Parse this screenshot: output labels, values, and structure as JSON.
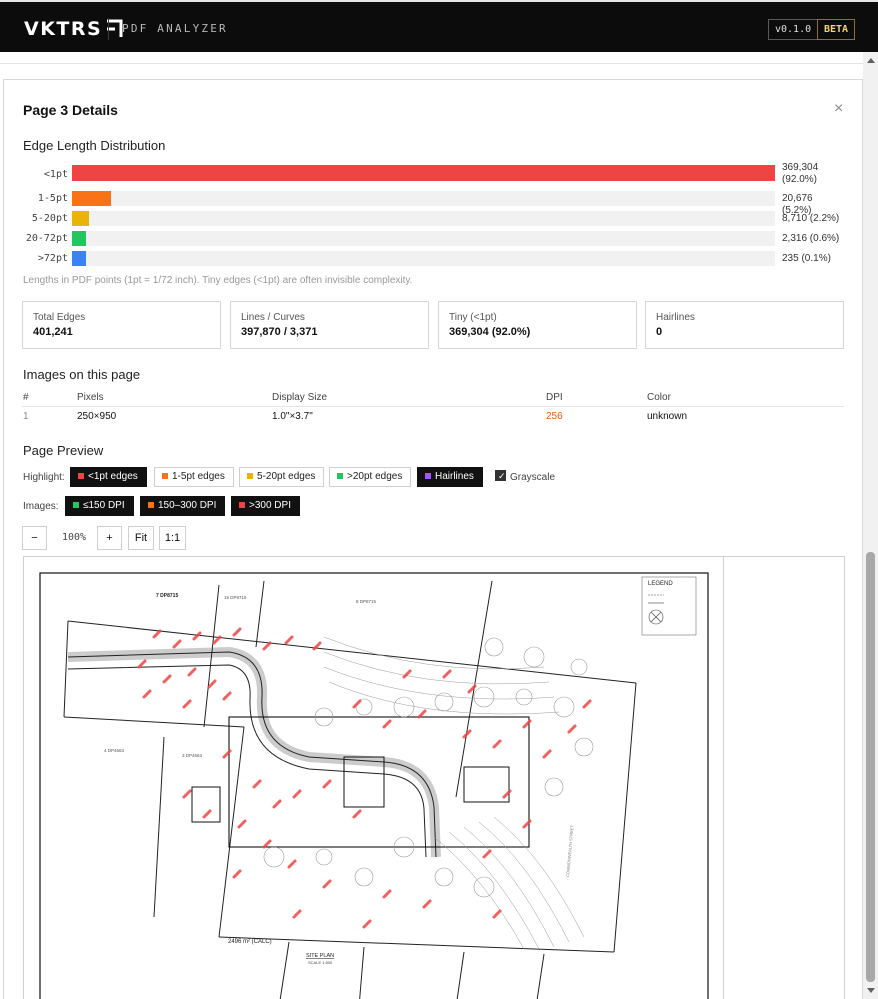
{
  "header": {
    "logo": "VKTRS",
    "app_name": "PDF ANALYZER",
    "version": "v0.1.0",
    "beta": "BETA"
  },
  "panel": {
    "title": "Page 3 Details",
    "close": "×"
  },
  "edge_distribution": {
    "title": "Edge Length Distribution",
    "rows": [
      {
        "label": "<1pt",
        "value": "369,304 (92.0%)",
        "fraction": 1.0,
        "color": "#ef4444"
      },
      {
        "label": "1-5pt",
        "value": "20,676 (5.2%)",
        "fraction": 0.056,
        "color": "#f97316"
      },
      {
        "label": "5-20pt",
        "value": "8,710 (2.2%)",
        "fraction": 0.024,
        "color": "#eab308"
      },
      {
        "label": "20-72pt",
        "value": "2,316 (0.6%)",
        "fraction": 0.02,
        "color": "#22c55e"
      },
      {
        "label": ">72pt",
        "value": "235 (0.1%)",
        "fraction": 0.02,
        "color": "#3b82f6"
      }
    ],
    "note": "Lengths in PDF points (1pt = 1/72 inch). Tiny edges (<1pt) are often invisible complexity."
  },
  "stats": [
    {
      "label": "Total Edges",
      "value": "401,241"
    },
    {
      "label": "Lines / Curves",
      "value": "397,870 / 3,371"
    },
    {
      "label": "Tiny (<1pt)",
      "value": "369,304 (92.0%)"
    },
    {
      "label": "Hairlines",
      "value": "0"
    }
  ],
  "images": {
    "title": "Images on this page",
    "columns": [
      "#",
      "Pixels",
      "Display Size",
      "DPI",
      "Color"
    ],
    "rows": [
      {
        "index": "1",
        "pixels": "250×950",
        "display_size": "1.0\"×3.7\"",
        "dpi": "256",
        "color": "unknown"
      }
    ],
    "dpi_color": "#ea580c"
  },
  "preview": {
    "title": "Page Preview",
    "highlight_label": "Highlight:",
    "highlight_chips": [
      {
        "label": "<1pt edges",
        "color": "#ef4444",
        "active": true
      },
      {
        "label": "1-5pt edges",
        "color": "#f97316",
        "active": false
      },
      {
        "label": "5-20pt edges",
        "color": "#eab308",
        "active": false
      },
      {
        "label": ">20pt edges",
        "color": "#22c55e",
        "active": false
      },
      {
        "label": "Hairlines",
        "color": "#a855f7",
        "active": true
      }
    ],
    "grayscale_label": "Grayscale",
    "images_label": "Images:",
    "image_chips": [
      {
        "label": "≤150 DPI",
        "color": "#22c55e"
      },
      {
        "label": "150–300 DPI",
        "color": "#f97316"
      },
      {
        "label": ">300 DPI",
        "color": "#ef4444"
      }
    ],
    "zoom_out": "−",
    "zoom_level": "100%",
    "zoom_in": "+",
    "fit": "Fit",
    "one_to_one": "1:1"
  },
  "drawing": {
    "lot_top": "7\nDP8715",
    "lot_15": "15\nDP8715",
    "lot_8": "8\nDP8715",
    "lot_left": "4\nDP4563",
    "lot_mid": "3\nDP4563",
    "legend": "LEGEND",
    "area": "2496 m² (CALC)",
    "site_plan": "SITE PLAN",
    "scale": "SCALE 1:500",
    "street": "COMMONWEALTH STREET"
  }
}
